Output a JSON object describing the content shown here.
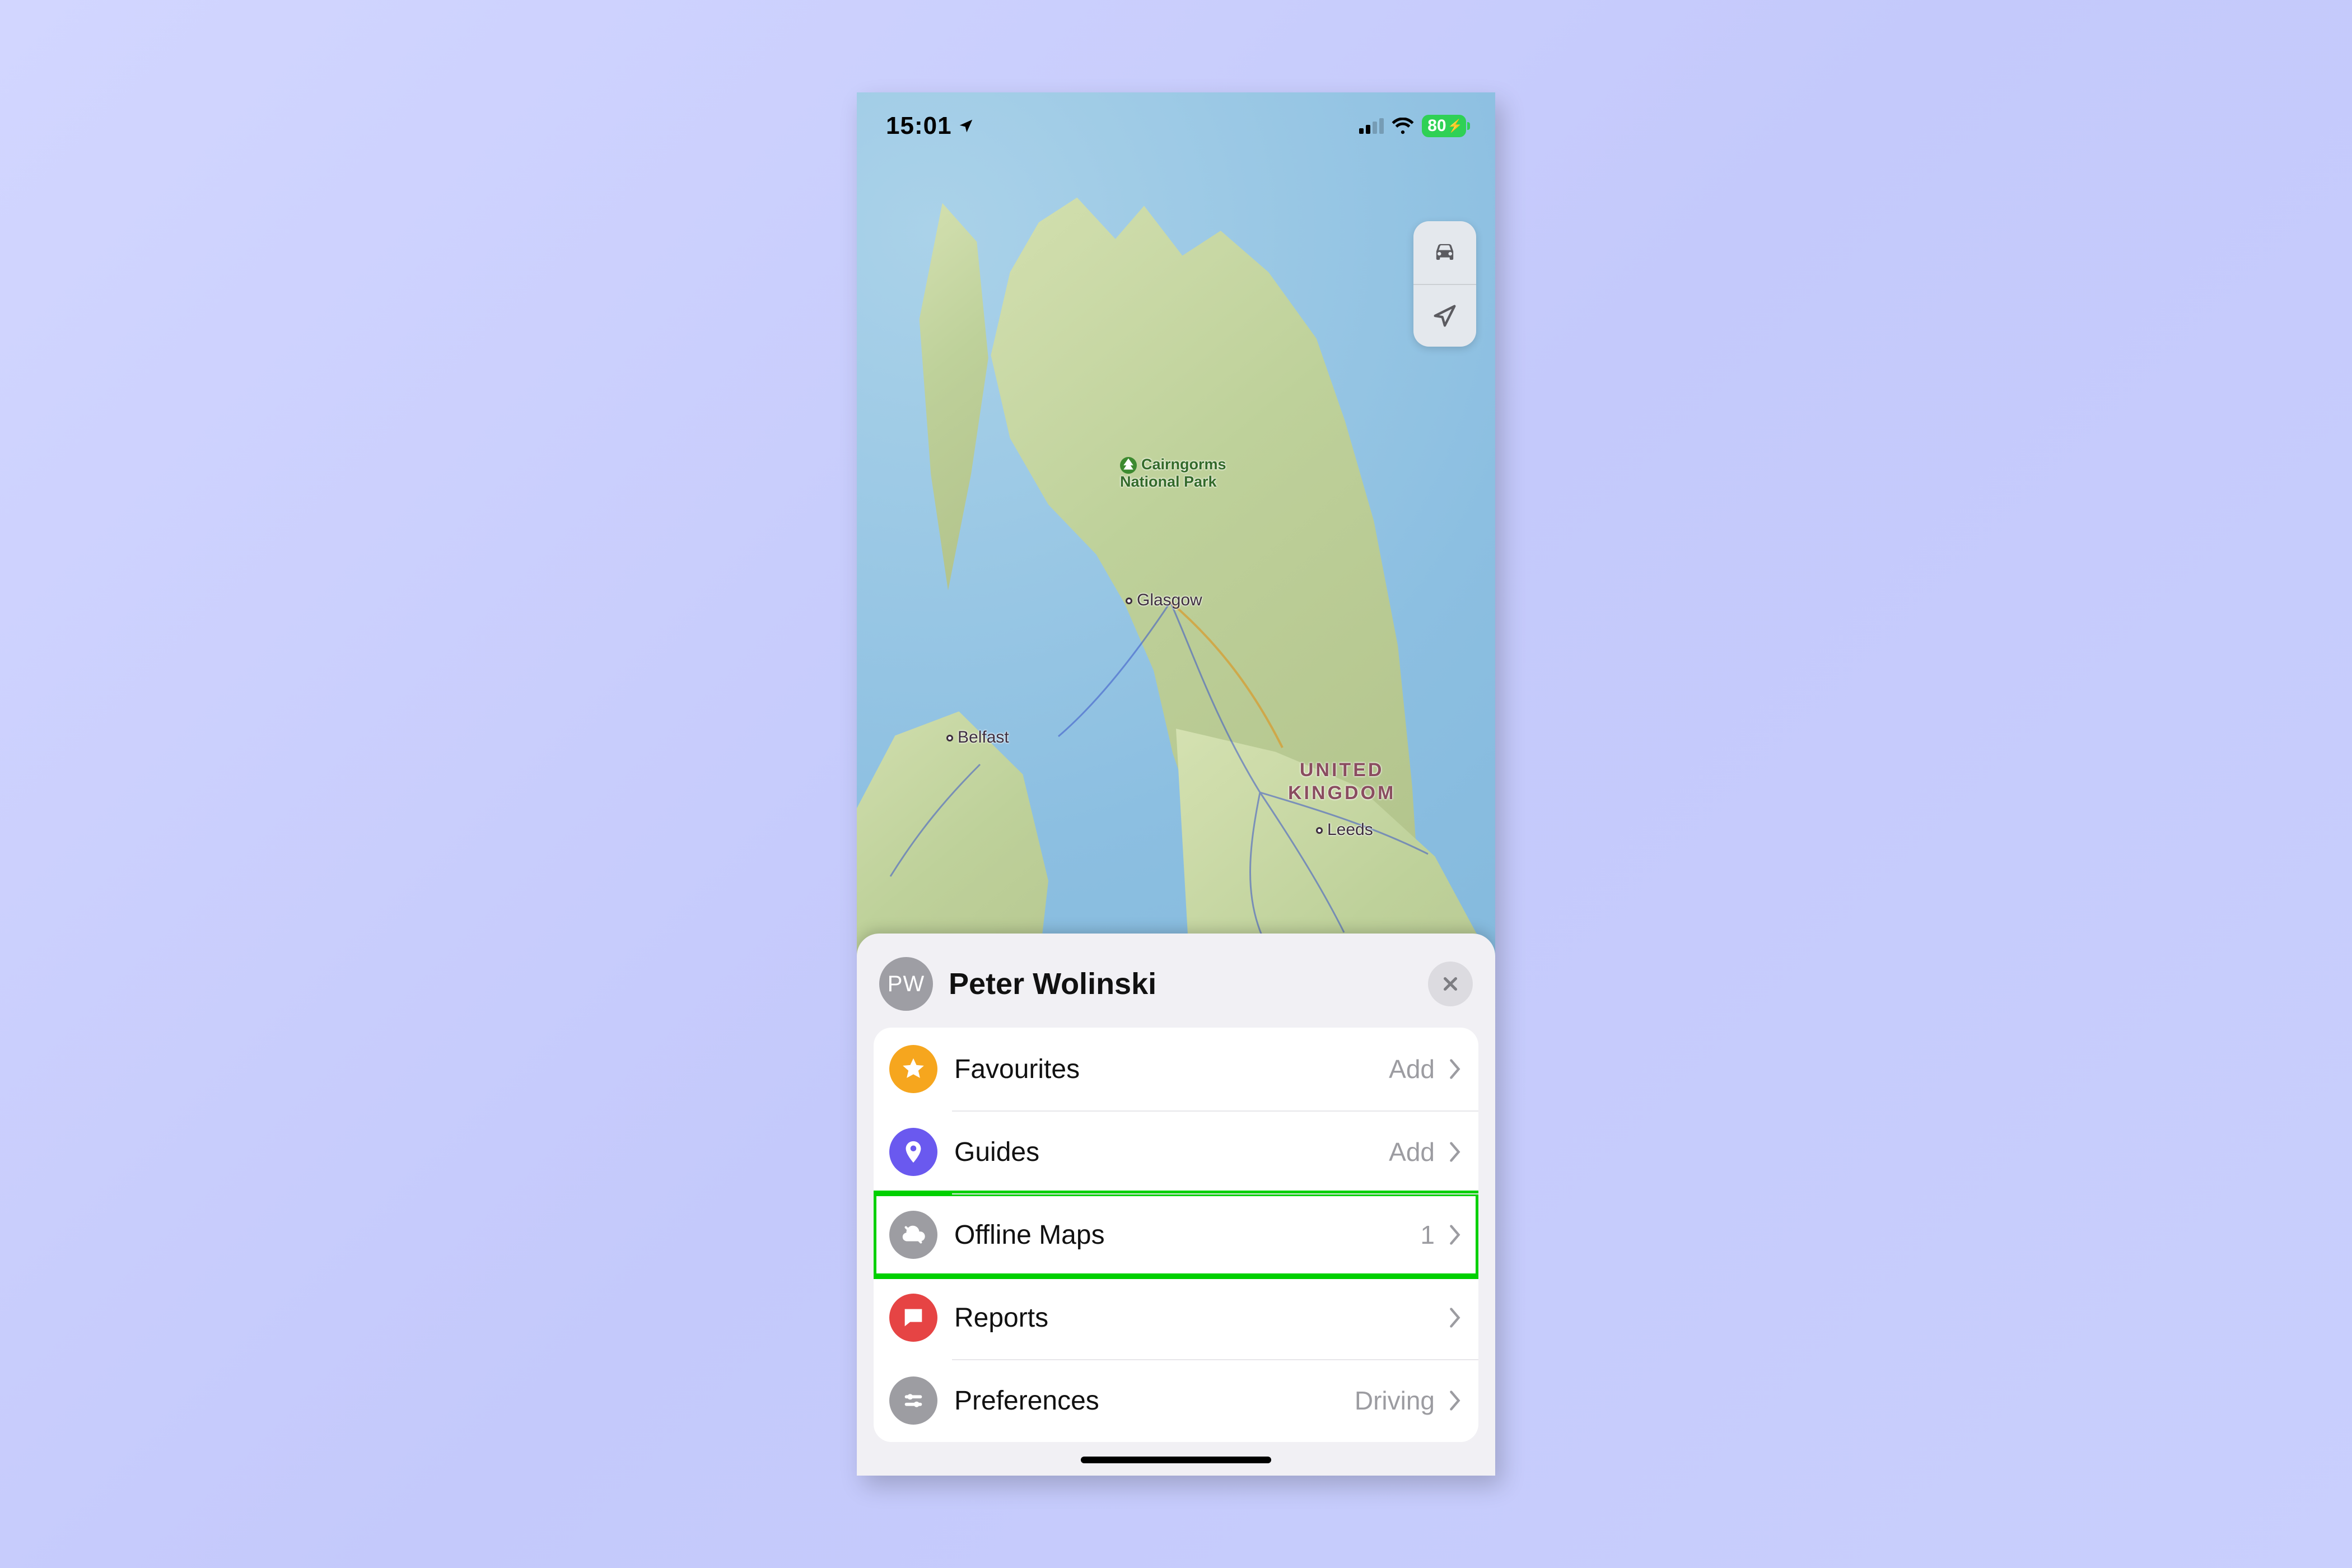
{
  "status_bar": {
    "time": "15:01",
    "battery_pct": "80"
  },
  "map": {
    "labels": {
      "park": "Cairngorms\nNational Park",
      "glasgow": "Glasgow",
      "belfast": "Belfast",
      "leeds": "Leeds",
      "country": "UNITED\nKINGDOM"
    }
  },
  "sheet": {
    "avatar_initials": "PW",
    "user_name": "Peter Wolinski",
    "rows": [
      {
        "id": "favourites",
        "label": "Favourites",
        "tail": "Add",
        "icon": "star-icon",
        "highlight": false
      },
      {
        "id": "guides",
        "label": "Guides",
        "tail": "Add",
        "icon": "pin-icon",
        "highlight": false
      },
      {
        "id": "offline",
        "label": "Offline Maps",
        "tail": "1",
        "icon": "cloud-off-icon",
        "highlight": true
      },
      {
        "id": "reports",
        "label": "Reports",
        "tail": "",
        "icon": "alert-icon",
        "highlight": false
      },
      {
        "id": "preferences",
        "label": "Preferences",
        "tail": "Driving",
        "icon": "sliders-icon",
        "highlight": false
      }
    ]
  }
}
